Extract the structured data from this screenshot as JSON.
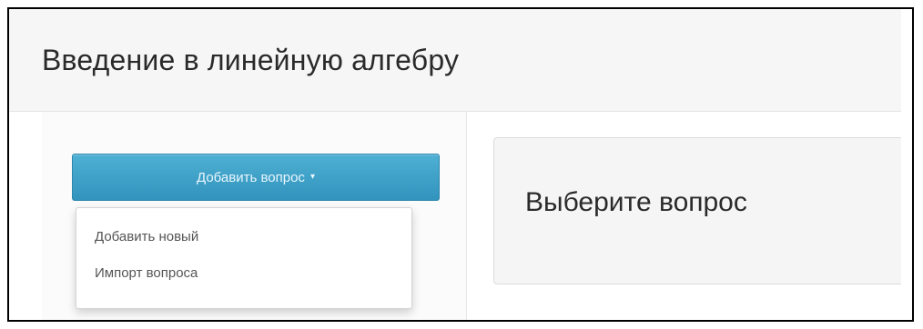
{
  "page": {
    "title": "Введение в линейную алгебру"
  },
  "toolbar": {
    "add_question_label": "Добавить вопрос",
    "caret_glyph": "▾"
  },
  "dropdown": {
    "items": [
      {
        "label": "Добавить новый"
      },
      {
        "label": "Импорт вопроса"
      }
    ]
  },
  "main": {
    "placeholder": "Выберите вопрос"
  },
  "icons": {
    "caret": "chevron-down-icon"
  },
  "colors": {
    "primary_button": "#3a9dc8",
    "header_bg": "#f6f6f6",
    "panel_bg": "#f5f5f5"
  }
}
